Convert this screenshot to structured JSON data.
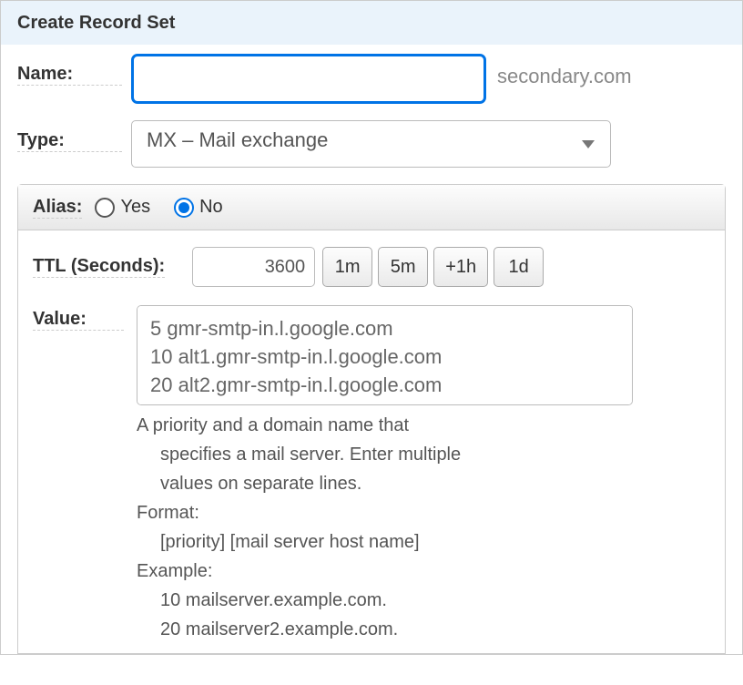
{
  "header": {
    "title": "Create Record Set"
  },
  "form": {
    "name_label": "Name:",
    "name_value": "",
    "domain_suffix": "secondary.com",
    "type_label": "Type:",
    "type_value": "MX – Mail exchange",
    "alias": {
      "label": "Alias:",
      "yes": "Yes",
      "no": "No",
      "selected": "no"
    },
    "ttl": {
      "label": "TTL (Seconds):",
      "value": "3600",
      "buttons": [
        "1m",
        "5m",
        "+1h",
        "1d"
      ]
    },
    "value": {
      "label": "Value:",
      "text": "5 gmr-smtp-in.l.google.com\n10 alt1.gmr-smtp-in.l.google.com\n20 alt2.gmr-smtp-in.l.google.com",
      "help": {
        "line1a": "A priority and a domain name that",
        "line1b": "specifies a mail server. Enter multiple",
        "line1c": "values on separate lines.",
        "format_label": "Format:",
        "format": "[priority] [mail server host name]",
        "example_label": "Example:",
        "example1": "10 mailserver.example.com.",
        "example2": "20 mailserver2.example.com."
      }
    }
  }
}
